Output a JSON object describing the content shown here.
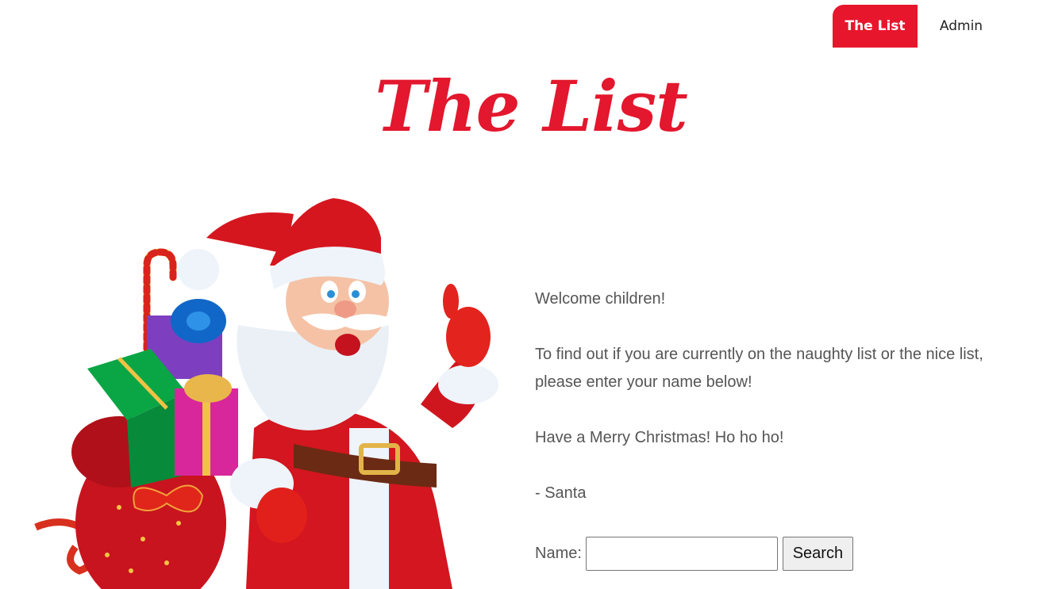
{
  "nav": {
    "items": [
      {
        "label": "The List",
        "active": true
      },
      {
        "label": "Admin",
        "active": false
      }
    ]
  },
  "hero": {
    "title": "The List",
    "accent_color": "#e8162c"
  },
  "message": {
    "greeting": "Welcome children!",
    "instructions": "To find out if you are currently on the naughty list or the nice list, please enter your name below!",
    "wish": "Have a Merry Christmas! Ho ho ho!",
    "signature": "- Santa"
  },
  "form": {
    "name_label": "Name:",
    "name_value": "",
    "search_label": "Search"
  }
}
